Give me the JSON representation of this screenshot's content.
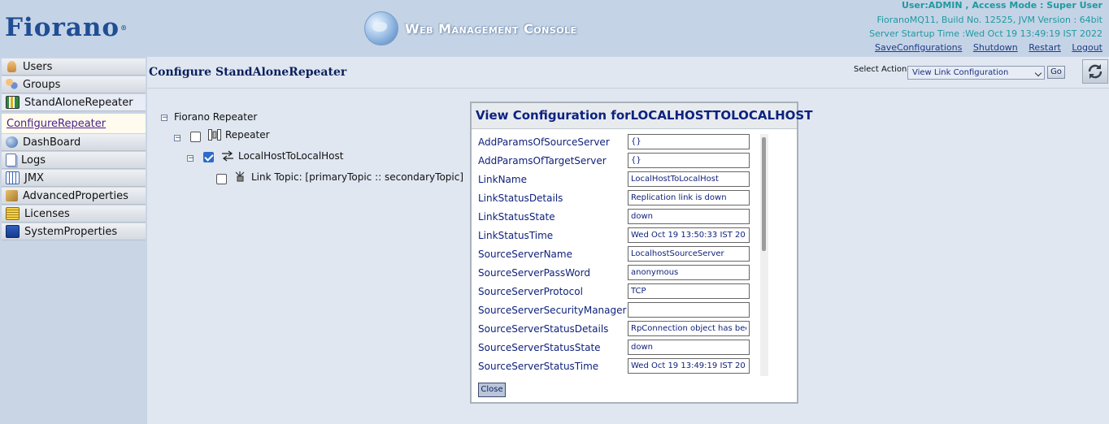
{
  "header": {
    "logo": "Fiorano",
    "logo_reg": "®",
    "console_title": "Web Management Console",
    "user_info": "User:ADMIN , Access Mode : Super User",
    "build_info": "FioranoMQ11, Build No. 12525, JVM Version : 64bit",
    "startup_info": "Server Startup Time :Wed Oct 19 13:49:19 IST 2022",
    "links": [
      "SaveConfigurations",
      "Shutdown",
      "Restart",
      "Logout"
    ]
  },
  "sidebar": {
    "items": [
      {
        "label": "Users",
        "icon": "users-icon"
      },
      {
        "label": "Groups",
        "icon": "groups-icon"
      },
      {
        "label": "StandAloneRepeater",
        "icon": "repeater-icon"
      },
      {
        "label": "DashBoard",
        "icon": "dashboard-icon"
      },
      {
        "label": "Logs",
        "icon": "logs-icon"
      },
      {
        "label": "JMX",
        "icon": "jmx-icon"
      },
      {
        "label": "AdvancedProperties",
        "icon": "advanced-properties-icon"
      },
      {
        "label": "Licenses",
        "icon": "licenses-icon"
      },
      {
        "label": "SystemProperties",
        "icon": "system-properties-icon"
      }
    ],
    "sub_item": "ConfigureRepeater"
  },
  "main": {
    "title": "Configure StandAloneRepeater",
    "select_label": "Select Action :",
    "select_value": "View Link Configuration",
    "go_label": "Go"
  },
  "tree": {
    "root": "Fiorano Repeater",
    "repeater": "Repeater",
    "link": "LocalHostToLocalHost",
    "topic": "Link Topic: [primaryTopic :: secondaryTopic]"
  },
  "dialog": {
    "title": "View Configuration forLOCALHOSTTOLOCALHOST",
    "rows": [
      {
        "label": "AddParamsOfSourceServer",
        "value": "{}"
      },
      {
        "label": "AddParamsOfTargetServer",
        "value": "{}"
      },
      {
        "label": "LinkName",
        "value": "LocalHostToLocalHost"
      },
      {
        "label": "LinkStatusDetails",
        "value": "Replication link is down"
      },
      {
        "label": "LinkStatusState",
        "value": "down"
      },
      {
        "label": "LinkStatusTime",
        "value": "Wed Oct 19 13:50:33 IST 20:"
      },
      {
        "label": "SourceServerName",
        "value": "LocalhostSourceServer"
      },
      {
        "label": "SourceServerPassWord",
        "value": "anonymous"
      },
      {
        "label": "SourceServerProtocol",
        "value": "TCP"
      },
      {
        "label": "SourceServerSecurityManager",
        "value": ""
      },
      {
        "label": "SourceServerStatusDetails",
        "value": "RpConnection object has bee"
      },
      {
        "label": "SourceServerStatusState",
        "value": "down"
      },
      {
        "label": "SourceServerStatusTime",
        "value": "Wed Oct 19 13:49:19 IST 20:"
      }
    ],
    "close_label": "Close"
  },
  "colors": {
    "header_bg": "#c5d3e6",
    "logo": "#1f4e94",
    "info_teal": "#1e9aa0",
    "dialog_title": "#0d2280"
  }
}
